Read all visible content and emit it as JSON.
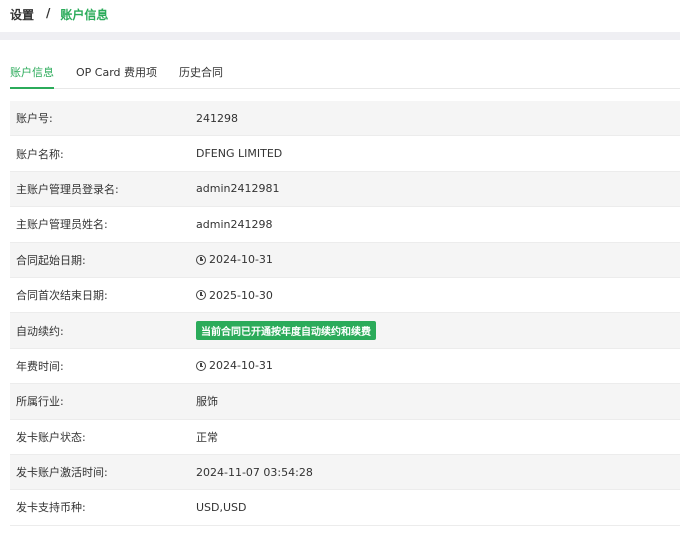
{
  "breadcrumb": {
    "root": "设置",
    "separator": "/",
    "current": "账户信息"
  },
  "tabs": [
    {
      "label": "账户信息",
      "active": true
    },
    {
      "label": "OP Card 费用项",
      "active": false
    },
    {
      "label": "历史合同",
      "active": false
    }
  ],
  "account": {
    "rows": [
      {
        "label": "账户号:",
        "value": "241298"
      },
      {
        "label": "账户名称:",
        "value": "DFENG LIMITED"
      },
      {
        "label": "主账户管理员登录名:",
        "value": "admin2412981"
      },
      {
        "label": "主账户管理员姓名:",
        "value": "admin241298"
      },
      {
        "label": "合同起始日期:",
        "value": "2024-10-31"
      },
      {
        "label": "合同首次结束日期:",
        "value": "2025-10-30"
      },
      {
        "label": "自动续约:",
        "value": "当前合同已开通按年度自动续约和续费"
      },
      {
        "label": "年费时间:",
        "value": "2024-10-31"
      },
      {
        "label": "所属行业:",
        "value": "服饰"
      },
      {
        "label": "发卡账户状态:",
        "value": "正常"
      },
      {
        "label": "发卡账户激活时间:",
        "value": "2024-11-07 03:54:28"
      },
      {
        "label": "发卡支持币种:",
        "value": "USD,USD"
      }
    ]
  },
  "icons": {
    "date_icon": "clock-icon"
  },
  "colors": {
    "accent": "#2bab5a",
    "page_band": "#efeff3",
    "row_alt": "#f5f5f5"
  }
}
